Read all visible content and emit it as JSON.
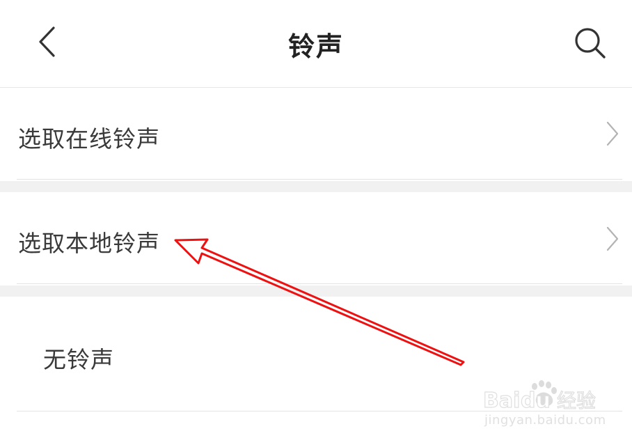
{
  "header": {
    "title": "铃声",
    "back_icon": "chevron-left-icon",
    "search_icon": "search-icon"
  },
  "rows": [
    {
      "label": "选取在线铃声",
      "icon": "chevron-right-icon"
    },
    {
      "label": "选取本地铃声",
      "icon": "chevron-right-icon"
    },
    {
      "label": "无铃声"
    }
  ],
  "annotation": {
    "color": "#ff0000",
    "shape": "arrow"
  },
  "watermark": {
    "brand": "Baidu经验",
    "url": "jingyan.baidu.com"
  }
}
